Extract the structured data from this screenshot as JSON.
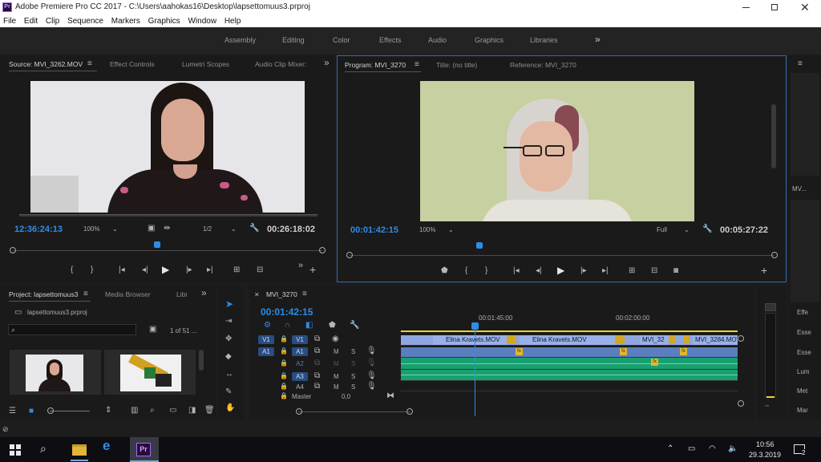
{
  "window": {
    "title": "Adobe Premiere Pro CC 2017 - C:\\Users\\aahokas16\\Desktop\\lapsettomuus3.prproj",
    "app_icon": "Pr"
  },
  "menu": [
    "File",
    "Edit",
    "Clip",
    "Sequence",
    "Markers",
    "Graphics",
    "Window",
    "Help"
  ],
  "workspaces": [
    "Assembly",
    "Editing",
    "Color",
    "Effects",
    "Audio",
    "Graphics",
    "Libraries"
  ],
  "source": {
    "tabs": [
      "Source: MVI_3262.MOV",
      "Effect Controls",
      "Lumetri Scopes",
      "Audio Clip Mixer:"
    ],
    "timecode": "12:36:24:13",
    "zoom": "100%",
    "resolution": "1/2",
    "duration": "00:26:18:02"
  },
  "program": {
    "tabs": [
      "Program: MVI_3270",
      "Title: (no title)",
      "Reference: MVI_3270"
    ],
    "timecode": "00:01:42:15",
    "zoom": "100%",
    "resolution": "Full",
    "duration": "00:05:27:22"
  },
  "project": {
    "tabs": [
      "Project: lapsettomuus3",
      "Media Browser",
      "Libi"
    ],
    "file": "lapsettomuus3.prproj",
    "count": "1 of 51 ..."
  },
  "timeline": {
    "tab": "MVI_3270",
    "timecode": "00:01:42:15",
    "ruler": [
      "00:01:45:00",
      "00:02:00:00"
    ],
    "video_tracks": [
      {
        "src": "V1",
        "name": "V1"
      }
    ],
    "audio_tracks": [
      {
        "src": "A1",
        "name": "A1"
      },
      {
        "src": "",
        "name": "A2"
      },
      {
        "src": "",
        "name": "A3"
      },
      {
        "src": "",
        "name": "A4"
      }
    ],
    "master": {
      "label": "Master",
      "value": "0,0"
    },
    "clips": [
      "Elina Kravets.MOV",
      "Elina Kravets.MOV",
      "MVI_32",
      "MVI_3284.MOV"
    ],
    "track_letters": {
      "mute": "M",
      "solo": "S"
    },
    "fx_badge": "fx"
  },
  "right_panel": [
    "MV...",
    "Effe",
    "Esse",
    "Esse",
    "Lum",
    "Met",
    "Mar"
  ],
  "taskbar": {
    "time": "10:56",
    "date": "29.3.2019",
    "notifications": "2",
    "app_label": "Pr"
  },
  "colors": {
    "accent": "#2d8ceb",
    "video_clip": "#9ab0e8",
    "audio_clip": "#1aa070",
    "playhead": "#2d8ceb",
    "work_area": "#e8d23a"
  }
}
